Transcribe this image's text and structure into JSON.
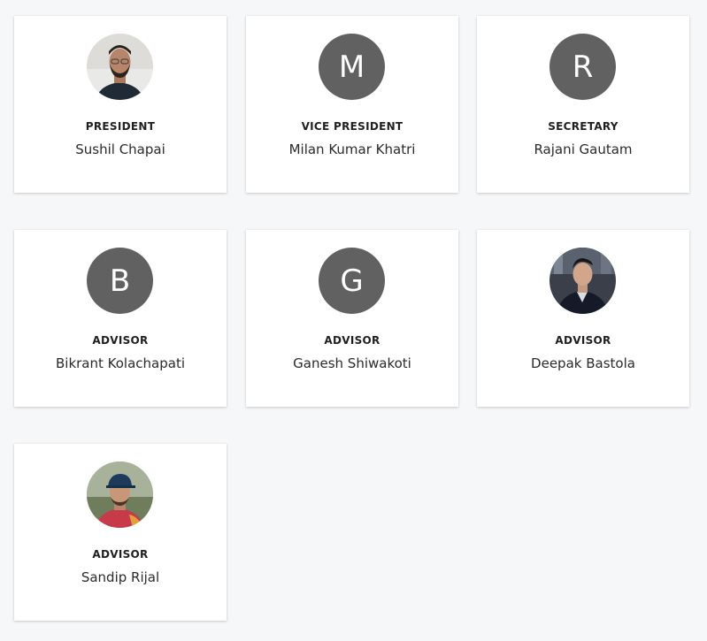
{
  "members": [
    {
      "role": "PRESIDENT",
      "name": "Sushil Chapai",
      "avatar": "photo",
      "avatar_letter": "",
      "photo": "man-with-beard-dark-shirt"
    },
    {
      "role": "VICE PRESIDENT",
      "name": "Milan Kumar Khatri",
      "avatar": "letter",
      "avatar_letter": "M",
      "photo": ""
    },
    {
      "role": "SECRETARY",
      "name": "Rajani Gautam",
      "avatar": "letter",
      "avatar_letter": "R",
      "photo": ""
    },
    {
      "role": "ADVISOR",
      "name": "Bikrant Kolachapati",
      "avatar": "letter",
      "avatar_letter": "B",
      "photo": ""
    },
    {
      "role": "ADVISOR",
      "name": "Ganesh Shiwakoti",
      "avatar": "letter",
      "avatar_letter": "G",
      "photo": ""
    },
    {
      "role": "ADVISOR",
      "name": "Deepak Bastola",
      "avatar": "photo",
      "avatar_letter": "",
      "photo": "man-in-suit-city-night"
    },
    {
      "role": "ADVISOR",
      "name": "Sandip Rijal",
      "avatar": "photo",
      "avatar_letter": "",
      "photo": "man-with-cap-outdoors"
    }
  ],
  "colors": {
    "page_background": "#f6f7f9",
    "card_background": "#ffffff",
    "letter_avatar_background": "#616161",
    "letter_avatar_text": "#ffffff"
  }
}
